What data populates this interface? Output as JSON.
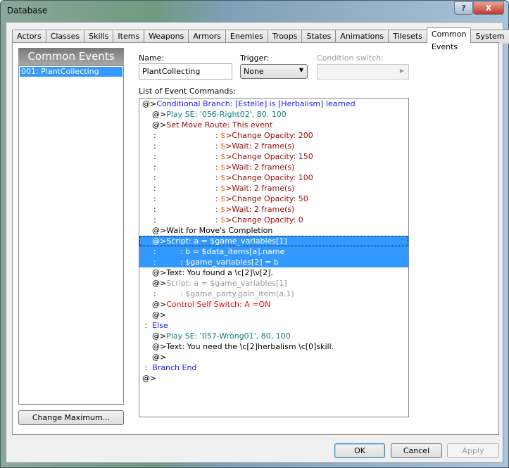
{
  "window": {
    "title": "Database",
    "help": "?",
    "close": "X"
  },
  "tabs": [
    "Actors",
    "Classes",
    "Skills",
    "Items",
    "Weapons",
    "Armors",
    "Enemies",
    "Troops",
    "States",
    "Animations",
    "Tilesets",
    "Common Events",
    "System"
  ],
  "active_tab": 11,
  "left": {
    "header": "Common Events",
    "items": [
      "001: PlantCollecting"
    ],
    "change_max": "Change Maximum..."
  },
  "form": {
    "name_label": "Name:",
    "name_value": "PlantCollecting",
    "trigger_label": "Trigger:",
    "trigger_value": "None",
    "condition_label": "Condition switch:",
    "list_label": "List of Event Commands:"
  },
  "colors": {
    "blue": "#1c1cf0",
    "teal": "#108080",
    "darkred": "#9a0a0a",
    "red": "#e81010",
    "gray": "#999999",
    "orange": "#e07020",
    "selection": "#3399ff"
  },
  "commands": [
    {
      "k": "cmd",
      "lv": 0,
      "p": "@>",
      "t": "Conditional Branch: [Estelle] is [Herbalism] learned",
      "c": "blue"
    },
    {
      "k": "cmd",
      "lv": 1,
      "p": "@>",
      "t": "Play SE: '056-Right02', 80, 100",
      "c": "teal"
    },
    {
      "k": "cmd",
      "lv": 1,
      "p": "@>",
      "t": "Set Move Route: This event",
      "c": "darkred"
    },
    {
      "k": "route",
      "t": "Change Opacity: 200"
    },
    {
      "k": "route",
      "t": "Wait: 2 frame(s)"
    },
    {
      "k": "route",
      "t": "Change Opacity: 150"
    },
    {
      "k": "route",
      "t": "Wait: 2 frame(s)"
    },
    {
      "k": "route",
      "t": "Change Opacity: 100"
    },
    {
      "k": "route",
      "t": "Wait: 2 frame(s)"
    },
    {
      "k": "route",
      "t": "Change Opacity: 50"
    },
    {
      "k": "route",
      "t": "Wait: 2 frame(s)"
    },
    {
      "k": "route",
      "t": "Change Opacity: 0"
    },
    {
      "k": "cmd",
      "lv": 1,
      "p": "@>",
      "t": "Wait for Move's Completion",
      "c": "black"
    },
    {
      "k": "cmd",
      "lv": 1,
      "p": "@>",
      "t": "Script: a = $game_variables[1]",
      "c": "black",
      "sel": true,
      "first": true
    },
    {
      "k": "cont",
      "t": "b = $data_items[a].name",
      "c": "black",
      "sel": true
    },
    {
      "k": "cont",
      "t": "$game_variables[2] = b",
      "c": "black",
      "sel": true
    },
    {
      "k": "cmd",
      "lv": 1,
      "p": "@>",
      "t": "Text: You found a \\c[2]\\v[2].",
      "c": "black"
    },
    {
      "k": "cmd",
      "lv": 1,
      "p": "@>",
      "t": "Script: a = $game_variables[1]",
      "c": "gray"
    },
    {
      "k": "cont",
      "t": "$game_party.gain_item(a,1)",
      "c": "gray"
    },
    {
      "k": "cmd",
      "lv": 1,
      "p": "@>",
      "t": "Control Self Switch: A =ON",
      "c": "red"
    },
    {
      "k": "cmd",
      "lv": 1,
      "p": "@>",
      "t": "",
      "c": "black"
    },
    {
      "k": "cmd",
      "lv": 0,
      "p": " :  ",
      "t": "Else",
      "c": "blue"
    },
    {
      "k": "cmd",
      "lv": 1,
      "p": "@>",
      "t": "Play SE: '057-Wrong01', 80, 100",
      "c": "teal"
    },
    {
      "k": "cmd",
      "lv": 1,
      "p": "@>",
      "t": "Text: You need the \\c[2]herbalism \\c[0]skill.",
      "c": "black"
    },
    {
      "k": "cmd",
      "lv": 1,
      "p": "@>",
      "t": "",
      "c": "black"
    },
    {
      "k": "cmd",
      "lv": 0,
      "p": " :  ",
      "t": "Branch End",
      "c": "blue"
    },
    {
      "k": "cmd",
      "lv": 0,
      "p": "@>",
      "t": "",
      "c": "black"
    }
  ],
  "footer": {
    "ok": "OK",
    "cancel": "Cancel",
    "apply": "Apply"
  }
}
